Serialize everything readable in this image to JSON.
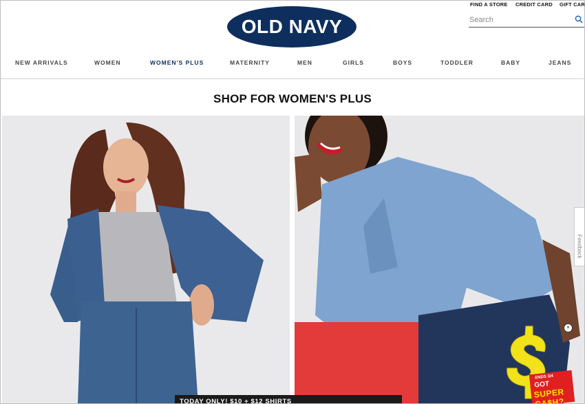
{
  "utility_links": [
    {
      "label": "FIND A STORE"
    },
    {
      "label": "CREDIT CARD"
    },
    {
      "label": "GIFT CARD"
    }
  ],
  "logo": {
    "text": "OLD NAVY",
    "color": "#0e2f5e"
  },
  "search": {
    "placeholder": "Search",
    "icon": "search-icon"
  },
  "nav": [
    {
      "label": "NEW ARRIVALS"
    },
    {
      "label": "WOMEN"
    },
    {
      "label": "WOMEN'S PLUS",
      "active": true
    },
    {
      "label": "MATERNITY"
    },
    {
      "label": "MEN"
    },
    {
      "label": "GIRLS"
    },
    {
      "label": "BOYS"
    },
    {
      "label": "TODDLER"
    },
    {
      "label": "BABY"
    },
    {
      "label": "JEANS"
    }
  ],
  "main": {
    "heading": "SHOP FOR WOMEN'S PLUS"
  },
  "promo_bar": {
    "text": "TODAY ONLY! $10 + $12 SHIRTS"
  },
  "feedback_tab": {
    "label": "Feedback"
  },
  "super_cash_badge": {
    "line1": "ENDS 3/4",
    "line2": "GOT",
    "line3": "SUPER CA$H?"
  },
  "colors": {
    "brand": "#0e2f5e",
    "promo_bg": "#1a1a1a",
    "badge_red": "#e02020",
    "badge_yellow": "#ffe600"
  }
}
